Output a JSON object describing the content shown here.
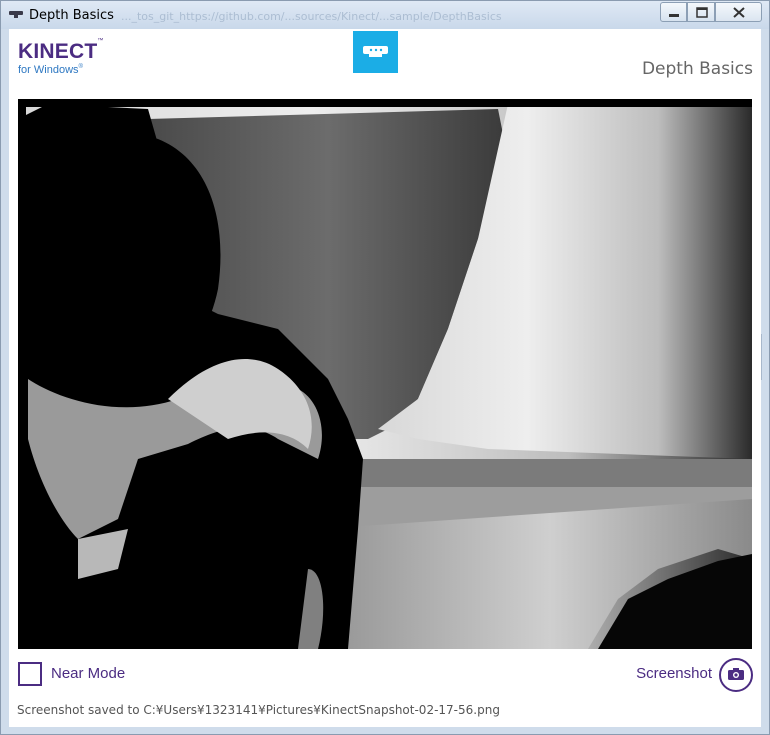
{
  "window": {
    "title": "Depth Basics",
    "background_url_text": "..._tos_git_https://github.com/...sources/Kinect/...sample/DepthBasics"
  },
  "header": {
    "logo_main": "KINECT",
    "logo_tm": "™",
    "logo_sub": "for Windows",
    "logo_sub_tm": "®",
    "app_title": "Depth Basics"
  },
  "controls": {
    "near_mode_label": "Near Mode",
    "near_mode_checked": false,
    "screenshot_label": "Screenshot"
  },
  "status": {
    "message": "Screenshot saved to C:¥Users¥1323141¥Pictures¥KinectSnapshot-02-17-56.png"
  },
  "theme": {
    "accent": "#4b2c82",
    "sensor_tile": "#1bade6",
    "logo_sub_color": "#2e78c2"
  },
  "icons": {
    "window_icon": "kinect-sensor-icon",
    "minimize": "minimize-icon",
    "maximize": "maximize-icon",
    "close": "close-icon",
    "sensor": "kinect-sensor-icon",
    "camera": "camera-icon"
  }
}
